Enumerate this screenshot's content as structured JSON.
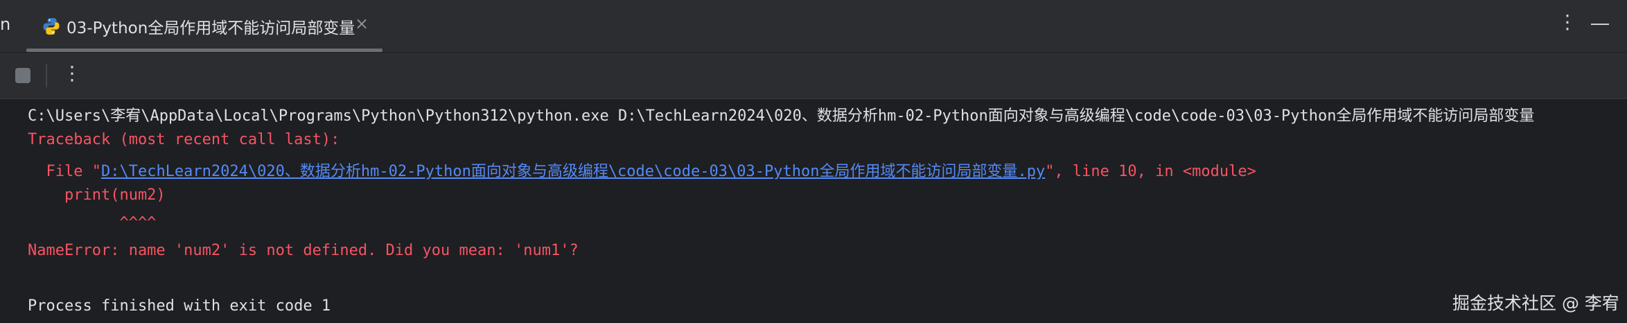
{
  "tabbar": {
    "cut_label": "n",
    "tab": {
      "title": "03-Python全局作用域不能访问局部变量",
      "close": "×"
    },
    "more_icon": "more-vertical-icon",
    "minimize_icon": "minimize-icon"
  },
  "toolbar": {
    "stop_icon": "stop-icon",
    "more_icon": "more-vertical-icon"
  },
  "console": {
    "command": "C:\\Users\\李宥\\AppData\\Local\\Programs\\Python\\Python312\\python.exe D:\\TechLearn2024\\020、数据分析hm-02-Python面向对象与高级编程\\code\\code-03\\03-Python全局作用域不能访问局部变量",
    "traceback_header": "Traceback (most recent call last):",
    "file_prefix": "  File \"",
    "file_path": "D:\\TechLearn2024\\020、数据分析hm-02-Python面向对象与高级编程\\code\\code-03\\03-Python全局作用域不能访问局部变量.py",
    "file_suffix": "\", line 10, in <module>",
    "code_line": "    print(num2)",
    "caret_line": "          ^^^^",
    "error_line": "NameError: name 'num2' is not defined. Did you mean: 'num1'?",
    "exit_line": "Process finished with exit code 1"
  },
  "watermark": "掘金技术社区 @ 李宥",
  "colors": {
    "background": "#1e1f22",
    "panel": "#2b2d30",
    "error": "#f75464",
    "link": "#548af7",
    "text": "#dfe1e5"
  }
}
